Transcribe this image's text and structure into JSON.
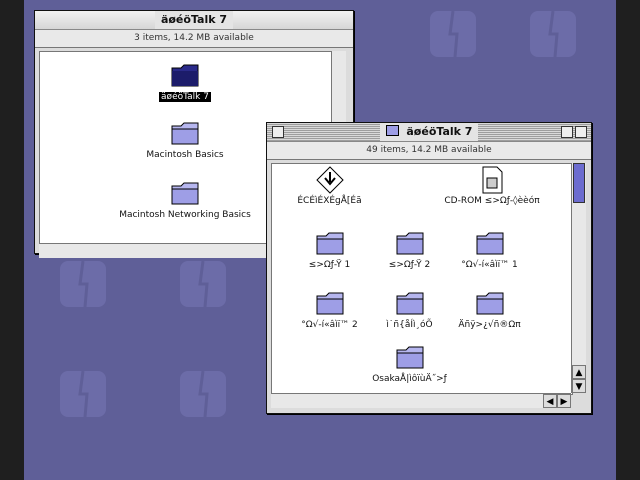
{
  "window_back": {
    "title": "äøéöTalk 7",
    "info": "3 items, 14.2 MB available",
    "items": [
      {
        "label": "äøéöTalk 7",
        "selected": true
      },
      {
        "label": "Macintosh Basics",
        "selected": false
      },
      {
        "label": "Macintosh Networking Basics",
        "selected": false
      }
    ]
  },
  "window_front": {
    "title": "äøéöTalk 7",
    "info": "49 items, 14.2 MB available",
    "items": [
      {
        "label": "ÉCÉìÉXÉgÅ[Éã"
      },
      {
        "label": "CD-ROM ≤>Ωƒ-◊èèóπ"
      },
      {
        "label": "≤>Ωƒ-Ÿ 1"
      },
      {
        "label": "≤>Ωƒ-Ÿ 2"
      },
      {
        "label": "°Ω√-í«âìï™ 1"
      },
      {
        "label": "°Ω√-í«âìï™ 2"
      },
      {
        "label": "ì˙ñ{åÍì¸óÕ"
      },
      {
        "label": "Äñÿ>¿√ñ®Ωπ"
      },
      {
        "label": "OsakaÅ|ìôïùÄ˝>ƒ"
      }
    ]
  }
}
